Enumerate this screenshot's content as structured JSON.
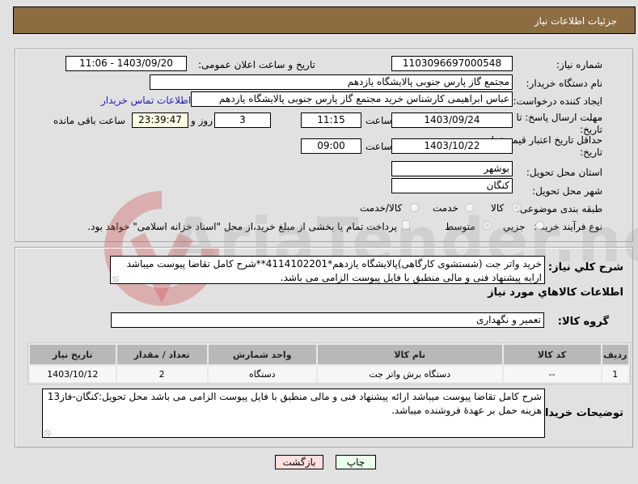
{
  "header": {
    "title": "جزئیات اطلاعات نیاز"
  },
  "form": {
    "need_number": {
      "label": "شماره نیاز:",
      "value": "1103096697000548"
    },
    "announce_datetime": {
      "label": "تاریخ و ساعت اعلان عمومی:",
      "value": "1403/09/20 - 11:06"
    },
    "buyer_org": {
      "label": "نام دستگاه خریدار:",
      "value": "مجتمع گاز پارس جنوبی  پالایشگاه یازدهم"
    },
    "requester": {
      "label": "ایجاد کننده درخواست:",
      "value": "عباس ابراهیمی کارشناس خرید مجتمع گاز پارس جنوبی  پالایشگاه یازدهم",
      "contact_link": "اطلاعات تماس خریدار"
    },
    "response_deadline": {
      "label_line1": "مهلت ارسال پاسخ: تا",
      "label_line2": "تاریخ:",
      "date": "1403/09/24",
      "time_label": "ساعت",
      "time": "11:15",
      "days": "3",
      "days_label": "روز و",
      "remaining": "23:39:47",
      "remaining_label": "ساعت باقی مانده"
    },
    "price_validity": {
      "label_line1": "حداقل تاریخ اعتبار قیمت: تا",
      "label_line2": "تاریخ:",
      "date": "1403/10/22",
      "time_label": "ساعت",
      "time": "09:00"
    },
    "province": {
      "label": "استان محل تحویل:",
      "value": "بوشهر"
    },
    "city": {
      "label": "شهر محل تحویل:",
      "value": "کنگان"
    },
    "category": {
      "label": "طبقه بندی موضوعی:",
      "options": [
        {
          "label": "کالا",
          "checked": true
        },
        {
          "label": "خدمت",
          "checked": false
        },
        {
          "label": "کالا/خدمت",
          "checked": false
        }
      ]
    },
    "purchase_process": {
      "label": "نوع فرآیند خرید :",
      "options": [
        {
          "label": "جزیي",
          "checked": false
        },
        {
          "label": "متوسط",
          "checked": true
        }
      ],
      "treasury_checkbox": {
        "label": "پرداخت تمام یا بخشی از مبلغ خرید،از محل \"اسناد خزانه اسلامی\" خواهد بود.",
        "checked": false
      }
    }
  },
  "summary": {
    "label": "شرح کلي نیاز:",
    "text": "خرید واتر جت (شستشوی کارگاهی)پالایشگاه یازدهم*4114102201**شرح کامل تقاضا پیوست میباشد ارایه پیشنهاد فنی و مالی منطبق با فایل پیوست الزامی می باشد."
  },
  "goods": {
    "section_title": "اطلاعات کالاهاي مورد نیاز",
    "group_label": "گروه کالا:",
    "group_value": "تعمیر و نگهداری",
    "table": {
      "headers": [
        "ردیف",
        "کد کالا",
        "نام کالا",
        "واحد شمارش",
        "تعداد / مقدار",
        "تاریخ نیاز"
      ],
      "rows": [
        [
          "1",
          "--",
          "دستگاه برش واتر جت",
          "دستگاه",
          "2",
          "1403/10/12"
        ]
      ]
    }
  },
  "buyer_notes": {
    "label": "توضیحات خریدار:",
    "text": "شرح کامل تقاضا پیوست میباشد ارائه پیشنهاد فنی و مالی منطبق با فایل پیوست الزامی می باشد محل تحویل:کنگان-فاز13 هزینه حمل بر عهدۀ فروشنده میباشد."
  },
  "buttons": {
    "print": "چاپ",
    "back": "بازگشت"
  },
  "watermark": {
    "text": "AriaTender.neT"
  },
  "colors": {
    "header_bg": "#8c6d42",
    "print_bg": "#eaffea",
    "back_bg": "#ffdede",
    "link": "#2020c0"
  }
}
